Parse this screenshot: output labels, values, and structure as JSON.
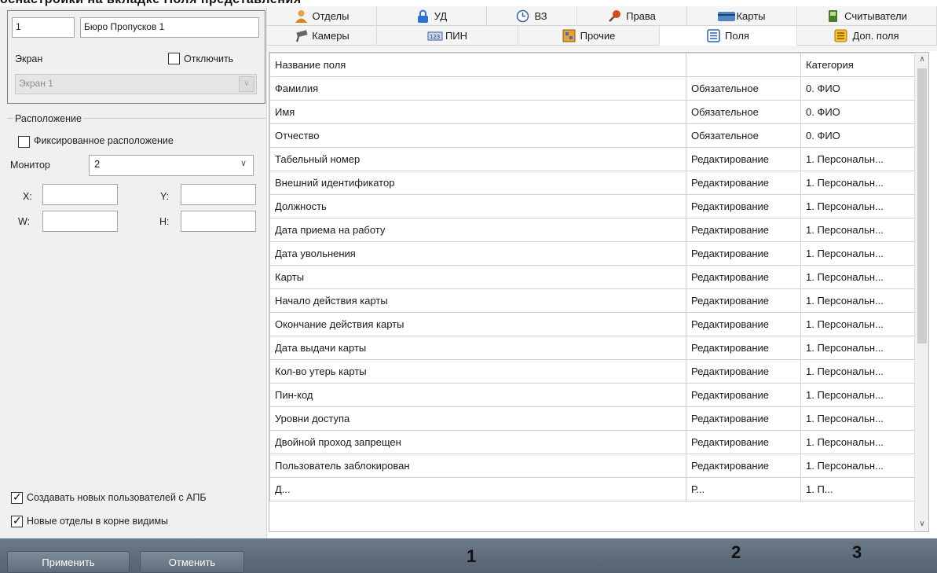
{
  "top_heading": "оснастройки на вкладке Поля представления",
  "object": {
    "id": "1",
    "name": "Бюро Пропусков 1",
    "screen_label": "Экран",
    "disable_label": "Отключить",
    "screen_value": "Экран 1"
  },
  "location": {
    "group_label": "Расположение",
    "fixed_label": "Фиксированное расположение",
    "monitor_label": "Монитор",
    "monitor_value": "2",
    "x_label": "X:",
    "y_label": "Y:",
    "w_label": "W:",
    "h_label": "H:"
  },
  "options": {
    "create_users_label": "Создавать новых пользователей с АПБ",
    "new_depts_label": "Новые отделы в корне видимы"
  },
  "tabs_row1": [
    {
      "label": "Отделы",
      "icon": "person-icon"
    },
    {
      "label": "УД",
      "icon": "lock-icon"
    },
    {
      "label": "ВЗ",
      "icon": "clock-icon"
    },
    {
      "label": "Права",
      "icon": "key-icon"
    },
    {
      "label": "Карты",
      "icon": "card-icon"
    },
    {
      "label": "Считыватели",
      "icon": "reader-icon"
    }
  ],
  "tabs_row2": [
    {
      "label": "Камеры",
      "icon": "camera-icon"
    },
    {
      "label": "ПИН",
      "icon": "pin-icon"
    },
    {
      "label": "Прочие",
      "icon": "misc-icon"
    },
    {
      "label": "Поля",
      "icon": "list-icon"
    },
    {
      "label": "Доп. поля",
      "icon": "list-yellow-icon"
    }
  ],
  "grid": {
    "headers": [
      "Название поля",
      "",
      "Категория"
    ],
    "rows": [
      [
        "Фамилия",
        "Обязательное",
        "0. ФИО"
      ],
      [
        "Имя",
        "Обязательное",
        "0. ФИО"
      ],
      [
        "Отчество",
        "Обязательное",
        "0. ФИО"
      ],
      [
        "Табельный номер",
        "Редактирование",
        "1. Персональн..."
      ],
      [
        "Внешний идентификатор",
        "Редактирование",
        "1. Персональн..."
      ],
      [
        "Должность",
        "Редактирование",
        "1. Персональн..."
      ],
      [
        "Дата приема на работу",
        "Редактирование",
        "1. Персональн..."
      ],
      [
        "Дата увольнения",
        "Редактирование",
        "1. Персональн..."
      ],
      [
        "Карты",
        "Редактирование",
        "1. Персональн..."
      ],
      [
        "Начало действия карты",
        "Редактирование",
        "1. Персональн..."
      ],
      [
        "Окончание действия карты",
        "Редактирование",
        "1. Персональн..."
      ],
      [
        "Дата выдачи карты",
        "Редактирование",
        "1. Персональн..."
      ],
      [
        "Кол-во утерь карты",
        "Редактирование",
        "1. Персональн..."
      ],
      [
        "Пин-код",
        "Редактирование",
        "1. Персональн..."
      ],
      [
        "Уровни доступа",
        "Редактирование",
        "1. Персональн..."
      ],
      [
        "Двойной проход запрещен",
        "Редактирование",
        "1. Персональн..."
      ],
      [
        "Пользователь заблокирован",
        "Редактирование",
        "1. Персональн..."
      ],
      [
        "Д...",
        "Р...",
        "1. П..."
      ]
    ]
  },
  "footer": {
    "apply_label": "Применить",
    "cancel_label": "Отменить",
    "callouts": [
      "1",
      "2",
      "3"
    ]
  },
  "colors": {
    "accent": "#2a62b5",
    "footer_bg": "#5f6d7a"
  }
}
